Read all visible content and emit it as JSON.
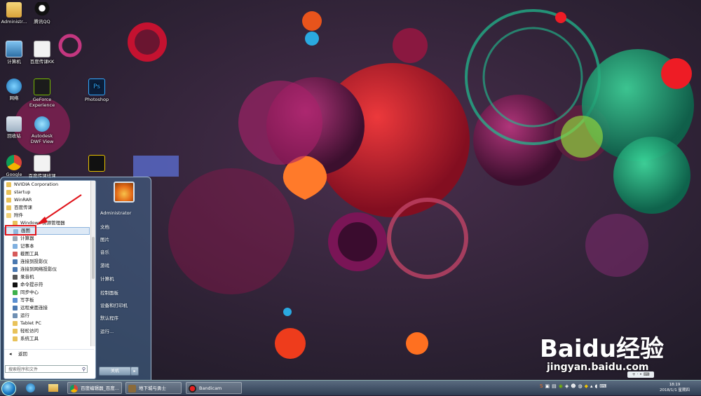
{
  "desktop": {
    "icons": [
      {
        "label": "Administr...",
        "name": "user-folder-icon"
      },
      {
        "label": "腾讯QQ",
        "name": "qq-icon"
      },
      {
        "label": "计算机",
        "name": "computer-icon"
      },
      {
        "label": "百度传课KK",
        "name": "kk-icon"
      },
      {
        "label": "网络",
        "name": "network-icon"
      },
      {
        "label": "GeForce Experience",
        "name": "geforce-icon"
      },
      {
        "label": "Photoshop",
        "name": "photoshop-icon"
      },
      {
        "label": "回收站",
        "name": "recycle-bin-icon"
      },
      {
        "label": "Autodesk DWF View",
        "name": "autodesk-icon"
      },
      {
        "label": "Google",
        "name": "chrome-icon"
      },
      {
        "label": "百度传课班课",
        "name": "classroom-icon"
      },
      {
        "label": "",
        "name": "app-icon"
      }
    ]
  },
  "start_menu": {
    "programs": [
      {
        "label": "NVIDIA Corporation",
        "type": "folder"
      },
      {
        "label": "startup",
        "type": "folder"
      },
      {
        "label": "WinRAR",
        "type": "folder"
      },
      {
        "label": "百度传课",
        "type": "folder"
      },
      {
        "label": "附件",
        "type": "folder"
      },
      {
        "label": "Windows 资源管理器",
        "type": "sub"
      },
      {
        "label": "画图",
        "type": "sub",
        "selected": true
      },
      {
        "label": "计算器",
        "type": "sub"
      },
      {
        "label": "记事本",
        "type": "sub"
      },
      {
        "label": "截图工具",
        "type": "sub"
      },
      {
        "label": "连接到投影仪",
        "type": "sub"
      },
      {
        "label": "连接到网络投影仪",
        "type": "sub"
      },
      {
        "label": "录音机",
        "type": "sub"
      },
      {
        "label": "命令提示符",
        "type": "sub"
      },
      {
        "label": "同步中心",
        "type": "sub"
      },
      {
        "label": "写字板",
        "type": "sub"
      },
      {
        "label": "远程桌面连接",
        "type": "sub"
      },
      {
        "label": "运行",
        "type": "sub"
      },
      {
        "label": "Tablet PC",
        "type": "subfolder"
      },
      {
        "label": "轻松访问",
        "type": "subfolder"
      },
      {
        "label": "系统工具",
        "type": "subfolder"
      }
    ],
    "back_label": "返回",
    "search_placeholder": "搜索程序和文件",
    "right_links": {
      "user": "Administrator",
      "documents": "文档",
      "pictures": "图片",
      "music": "音乐",
      "games": "游戏",
      "computer": "计算机",
      "control_panel": "控制面板",
      "devices": "设备和打印机",
      "defaults": "默认程序",
      "run": "运行..."
    },
    "shutdown_label": "关机"
  },
  "taskbar": {
    "windows": [
      {
        "label": "百度编辑器_百度..."
      },
      {
        "label": "地下城与勇士"
      },
      {
        "label": "Bandicam"
      }
    ],
    "clock_time": "18:19",
    "clock_date": "2018/1/1 星期四"
  },
  "watermark": {
    "logo": "Baidu经验",
    "url": "jingyan.baidu.com"
  },
  "colors": {
    "highlight": "#e0141b",
    "selection": "#dde9f6"
  }
}
